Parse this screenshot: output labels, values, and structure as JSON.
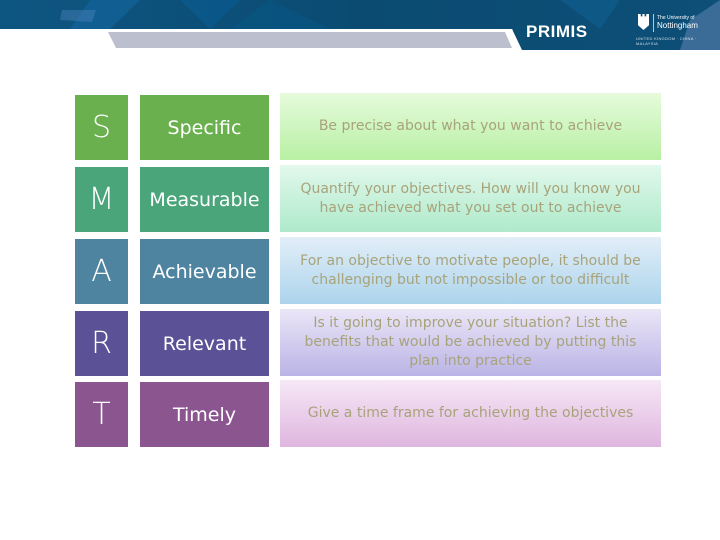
{
  "header": {
    "brand": "PRIMIS",
    "university_small": "The University of",
    "university_name": "Nottingham",
    "university_tagline": "UNITED KINGDOM · CHINA · MALAYSIA",
    "colors": {
      "banner_dark": "#0b4a6e",
      "banner_mid": "#0f5f8c",
      "band_grey": "#bcc0ce"
    }
  },
  "smart": {
    "text_color": "#a8a37a",
    "rows": [
      {
        "letter": "S",
        "word": "Specific",
        "description": "Be precise about what you want to achieve",
        "color": "#6ab04f",
        "desc_top": "#e6fbdc",
        "desc_bottom": "#b8f0a4"
      },
      {
        "letter": "M",
        "word": "Measurable",
        "description": "Quantify your objectives.  How will you know you have achieved what you set out to achieve",
        "color": "#4ba57b",
        "desc_top": "#e2f8ec",
        "desc_bottom": "#aeeacb"
      },
      {
        "letter": "A",
        "word": "Achievable",
        "description": "For an objective to motivate people, it should be challenging but not impossible or too difficult",
        "color": "#4e84a0",
        "desc_top": "#e2eef8",
        "desc_bottom": "#acd4ec"
      },
      {
        "letter": "R",
        "word": "Relevant",
        "description": "Is it going to improve your situation?  List the benefits that would be achieved by putting this plan into practice",
        "color": "#5a5196",
        "desc_top": "#ebe6f7",
        "desc_bottom": "#bab4e6"
      },
      {
        "letter": "T",
        "word": "Timely",
        "description": "Give a time frame for achieving the objectives",
        "color": "#8b568f",
        "desc_top": "#f6e8f6",
        "desc_bottom": "#dfb6df"
      }
    ]
  }
}
